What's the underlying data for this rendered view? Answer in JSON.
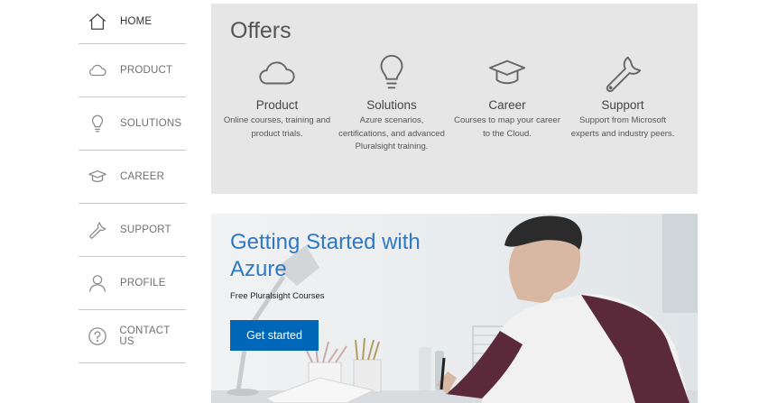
{
  "nav": {
    "items": [
      {
        "label": "HOME",
        "icon": "home-icon"
      },
      {
        "label": "PRODUCT",
        "icon": "cloud-icon"
      },
      {
        "label": "SOLUTIONS",
        "icon": "lightbulb-icon"
      },
      {
        "label": "CAREER",
        "icon": "graduation-cap-icon"
      },
      {
        "label": "SUPPORT",
        "icon": "wrench-icon"
      },
      {
        "label": "PROFILE",
        "icon": "person-icon"
      },
      {
        "label": "CONTACT US",
        "icon": "question-icon"
      }
    ]
  },
  "offers": {
    "title": "Offers",
    "items": [
      {
        "name": "Product",
        "description": "Online courses, training and product trials.",
        "icon": "cloud-icon"
      },
      {
        "name": "Solutions",
        "description": "Azure scenarios, certifications, and advanced Pluralsight training.",
        "icon": "lightbulb-icon"
      },
      {
        "name": "Career",
        "description": "Courses to map your career to the Cloud.",
        "icon": "graduation-cap-icon"
      },
      {
        "name": "Support",
        "description": "Support from Microsoft experts and industry peers.",
        "icon": "wrench-icon"
      }
    ]
  },
  "hero": {
    "title": "Getting Started with Azure",
    "subtitle": "Free Pluralsight Courses",
    "button_label": "Get started"
  },
  "colors": {
    "accent": "#0067b8",
    "hero_title": "#2f78c4",
    "panel_bg": "#e6e6e6"
  }
}
